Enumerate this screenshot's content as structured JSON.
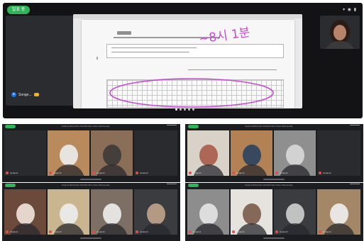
{
  "top_call": {
    "timer_pill": "발표 중",
    "status_icons": "▾ ◉ ▮",
    "presenter_name": "Songe...",
    "mic_icon": "mic-icon",
    "document": {
      "tag": "",
      "handwritten_note": "~8시 1분"
    }
  },
  "meetings": [
    {
      "title": "Student ENGLISH ONLINE Mini Class Wednesday",
      "participants": [
        "student1",
        "student2",
        "student3",
        "student4"
      ]
    },
    {
      "title": "Student ENGLISH ONLINE Mini Class Wednesday",
      "participants": [
        "student1",
        "student2",
        "student3",
        "student4"
      ]
    },
    {
      "title": "Student ENGLISH ONLINE Mini Class Wednesday",
      "participants": [
        "student1",
        "student2",
        "student3",
        "student4"
      ]
    },
    {
      "title": "Student ENGLISH ONLINE Mini Class Wednesday",
      "participants": [
        "student1",
        "student2",
        "student3",
        "student4"
      ]
    }
  ],
  "colors": {
    "accent_green": "#2fb457",
    "mic_blue": "#1a73e8",
    "annotation_pink": "#c94ad6"
  }
}
